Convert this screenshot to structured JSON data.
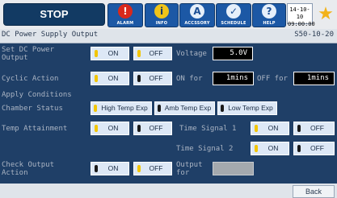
{
  "header": {
    "stop_label": "STOP",
    "toolbar": [
      {
        "label": "ALARM",
        "icon": "exclamation-icon",
        "glyph": "!",
        "color": "#d9291c"
      },
      {
        "label": "INFO",
        "icon": "info-icon",
        "glyph": "i",
        "color": "#f0c419"
      },
      {
        "label": "ACCSSORY",
        "icon": "accessory-icon",
        "glyph": "A",
        "color": "#2f5fae"
      },
      {
        "label": "SCHEDULE",
        "icon": "schedule-check-icon",
        "glyph": "✓",
        "color": "#2f5fae"
      },
      {
        "label": "HELP",
        "icon": "help-icon",
        "glyph": "?",
        "color": "#2f5fae"
      }
    ],
    "date": "14-10-10",
    "time": "09:00:00"
  },
  "title": {
    "text": "DC Power Supply Output",
    "code": "S50-10-20"
  },
  "rows": {
    "set_dc_power": {
      "label": "Set DC Power Output",
      "on": "ON",
      "off": "OFF",
      "voltage_label": "Voltage",
      "voltage_value": "5.0V"
    },
    "cyclic_action": {
      "label": "Cyclic Action",
      "on": "ON",
      "off": "OFF",
      "on_for_label": "ON for",
      "on_for_value": "1mins",
      "off_for_label": "OFF for",
      "off_for_value": "1mins"
    },
    "apply_conditions": {
      "label": "Apply Conditions"
    },
    "chamber_status": {
      "label": "Chamber Status",
      "high": "High Temp Exp",
      "amb": "Amb Temp Exp",
      "low": "Low Temp Exp"
    },
    "temp_attainment": {
      "label": "Temp Attainment",
      "on": "ON",
      "off": "OFF",
      "signal1_label": "Time Signal 1",
      "signal1_on": "ON",
      "signal1_off": "OFF"
    },
    "time_signal_2": {
      "label": "Time Signal 2",
      "on": "ON",
      "off": "OFF"
    },
    "check_output": {
      "label": "Check Output Action",
      "on": "ON",
      "off": "OFF",
      "output_for_label": "Output for"
    }
  },
  "footer": {
    "back_label": "Back"
  },
  "colors": {
    "background": "#1f3f67",
    "led_on": "#f2c500",
    "led_off": "#1a1a1a",
    "star": "#f2b21a"
  }
}
